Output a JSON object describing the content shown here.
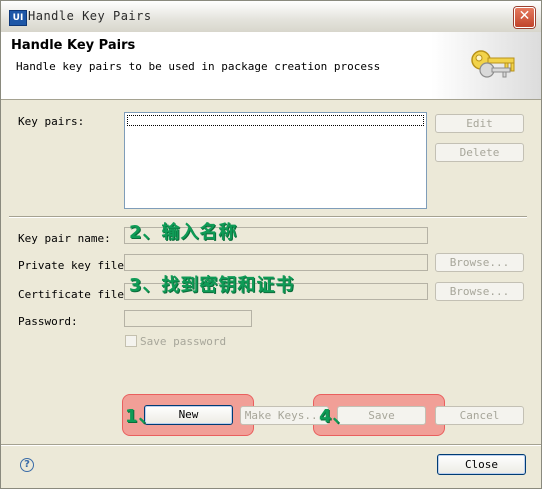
{
  "window": {
    "title": "Handle Key Pairs",
    "app_icon_text": "UI",
    "close_glyph": "✕"
  },
  "header": {
    "title": "Handle Key Pairs",
    "description": "Handle key pairs to be used in package creation process",
    "icon": "keys-icon"
  },
  "form": {
    "key_pairs_label": "Key pairs:",
    "key_pair_name_label": "Key pair name:",
    "private_key_label": "Private key file:",
    "certificate_label": "Certificate file:",
    "password_label": "Password:",
    "save_password_label": "Save password",
    "key_pair_name_value": "",
    "private_key_value": "",
    "certificate_value": "",
    "password_value": ""
  },
  "buttons": {
    "edit": "Edit",
    "delete": "Delete",
    "browse_private": "Browse...",
    "browse_cert": "Browse...",
    "new": "New",
    "make_keys": "Make Keys...",
    "save": "Save",
    "cancel": "Cancel",
    "close": "Close"
  },
  "annotations": {
    "step1": "1、",
    "step2": "2、输入名称",
    "step3": "3、找到密钥和证书",
    "step4": "4、"
  },
  "colors": {
    "annotation_green": "#0f9b56",
    "highlight_red": "#f56262",
    "dialog_bg": "#ece9d8"
  }
}
